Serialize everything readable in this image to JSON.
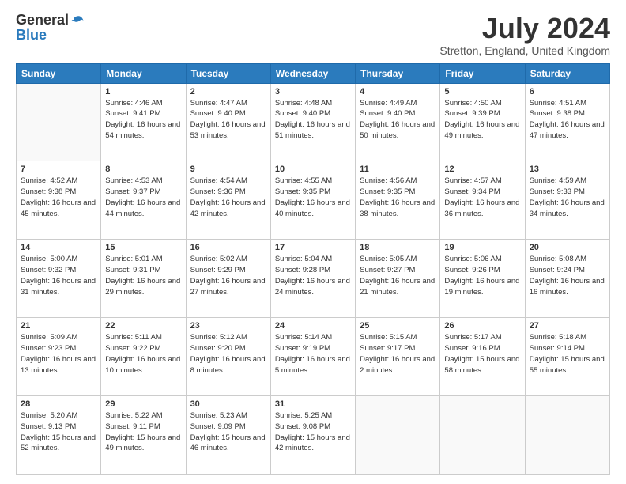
{
  "logo": {
    "general": "General",
    "blue": "Blue"
  },
  "header": {
    "month": "July 2024",
    "location": "Stretton, England, United Kingdom"
  },
  "weekdays": [
    "Sunday",
    "Monday",
    "Tuesday",
    "Wednesday",
    "Thursday",
    "Friday",
    "Saturday"
  ],
  "weeks": [
    [
      {
        "day": "",
        "sunrise": "",
        "sunset": "",
        "daylight": ""
      },
      {
        "day": "1",
        "sunrise": "Sunrise: 4:46 AM",
        "sunset": "Sunset: 9:41 PM",
        "daylight": "Daylight: 16 hours and 54 minutes."
      },
      {
        "day": "2",
        "sunrise": "Sunrise: 4:47 AM",
        "sunset": "Sunset: 9:40 PM",
        "daylight": "Daylight: 16 hours and 53 minutes."
      },
      {
        "day": "3",
        "sunrise": "Sunrise: 4:48 AM",
        "sunset": "Sunset: 9:40 PM",
        "daylight": "Daylight: 16 hours and 51 minutes."
      },
      {
        "day": "4",
        "sunrise": "Sunrise: 4:49 AM",
        "sunset": "Sunset: 9:40 PM",
        "daylight": "Daylight: 16 hours and 50 minutes."
      },
      {
        "day": "5",
        "sunrise": "Sunrise: 4:50 AM",
        "sunset": "Sunset: 9:39 PM",
        "daylight": "Daylight: 16 hours and 49 minutes."
      },
      {
        "day": "6",
        "sunrise": "Sunrise: 4:51 AM",
        "sunset": "Sunset: 9:38 PM",
        "daylight": "Daylight: 16 hours and 47 minutes."
      }
    ],
    [
      {
        "day": "7",
        "sunrise": "Sunrise: 4:52 AM",
        "sunset": "Sunset: 9:38 PM",
        "daylight": "Daylight: 16 hours and 45 minutes."
      },
      {
        "day": "8",
        "sunrise": "Sunrise: 4:53 AM",
        "sunset": "Sunset: 9:37 PM",
        "daylight": "Daylight: 16 hours and 44 minutes."
      },
      {
        "day": "9",
        "sunrise": "Sunrise: 4:54 AM",
        "sunset": "Sunset: 9:36 PM",
        "daylight": "Daylight: 16 hours and 42 minutes."
      },
      {
        "day": "10",
        "sunrise": "Sunrise: 4:55 AM",
        "sunset": "Sunset: 9:35 PM",
        "daylight": "Daylight: 16 hours and 40 minutes."
      },
      {
        "day": "11",
        "sunrise": "Sunrise: 4:56 AM",
        "sunset": "Sunset: 9:35 PM",
        "daylight": "Daylight: 16 hours and 38 minutes."
      },
      {
        "day": "12",
        "sunrise": "Sunrise: 4:57 AM",
        "sunset": "Sunset: 9:34 PM",
        "daylight": "Daylight: 16 hours and 36 minutes."
      },
      {
        "day": "13",
        "sunrise": "Sunrise: 4:59 AM",
        "sunset": "Sunset: 9:33 PM",
        "daylight": "Daylight: 16 hours and 34 minutes."
      }
    ],
    [
      {
        "day": "14",
        "sunrise": "Sunrise: 5:00 AM",
        "sunset": "Sunset: 9:32 PM",
        "daylight": "Daylight: 16 hours and 31 minutes."
      },
      {
        "day": "15",
        "sunrise": "Sunrise: 5:01 AM",
        "sunset": "Sunset: 9:31 PM",
        "daylight": "Daylight: 16 hours and 29 minutes."
      },
      {
        "day": "16",
        "sunrise": "Sunrise: 5:02 AM",
        "sunset": "Sunset: 9:29 PM",
        "daylight": "Daylight: 16 hours and 27 minutes."
      },
      {
        "day": "17",
        "sunrise": "Sunrise: 5:04 AM",
        "sunset": "Sunset: 9:28 PM",
        "daylight": "Daylight: 16 hours and 24 minutes."
      },
      {
        "day": "18",
        "sunrise": "Sunrise: 5:05 AM",
        "sunset": "Sunset: 9:27 PM",
        "daylight": "Daylight: 16 hours and 21 minutes."
      },
      {
        "day": "19",
        "sunrise": "Sunrise: 5:06 AM",
        "sunset": "Sunset: 9:26 PM",
        "daylight": "Daylight: 16 hours and 19 minutes."
      },
      {
        "day": "20",
        "sunrise": "Sunrise: 5:08 AM",
        "sunset": "Sunset: 9:24 PM",
        "daylight": "Daylight: 16 hours and 16 minutes."
      }
    ],
    [
      {
        "day": "21",
        "sunrise": "Sunrise: 5:09 AM",
        "sunset": "Sunset: 9:23 PM",
        "daylight": "Daylight: 16 hours and 13 minutes."
      },
      {
        "day": "22",
        "sunrise": "Sunrise: 5:11 AM",
        "sunset": "Sunset: 9:22 PM",
        "daylight": "Daylight: 16 hours and 10 minutes."
      },
      {
        "day": "23",
        "sunrise": "Sunrise: 5:12 AM",
        "sunset": "Sunset: 9:20 PM",
        "daylight": "Daylight: 16 hours and 8 minutes."
      },
      {
        "day": "24",
        "sunrise": "Sunrise: 5:14 AM",
        "sunset": "Sunset: 9:19 PM",
        "daylight": "Daylight: 16 hours and 5 minutes."
      },
      {
        "day": "25",
        "sunrise": "Sunrise: 5:15 AM",
        "sunset": "Sunset: 9:17 PM",
        "daylight": "Daylight: 16 hours and 2 minutes."
      },
      {
        "day": "26",
        "sunrise": "Sunrise: 5:17 AM",
        "sunset": "Sunset: 9:16 PM",
        "daylight": "Daylight: 15 hours and 58 minutes."
      },
      {
        "day": "27",
        "sunrise": "Sunrise: 5:18 AM",
        "sunset": "Sunset: 9:14 PM",
        "daylight": "Daylight: 15 hours and 55 minutes."
      }
    ],
    [
      {
        "day": "28",
        "sunrise": "Sunrise: 5:20 AM",
        "sunset": "Sunset: 9:13 PM",
        "daylight": "Daylight: 15 hours and 52 minutes."
      },
      {
        "day": "29",
        "sunrise": "Sunrise: 5:22 AM",
        "sunset": "Sunset: 9:11 PM",
        "daylight": "Daylight: 15 hours and 49 minutes."
      },
      {
        "day": "30",
        "sunrise": "Sunrise: 5:23 AM",
        "sunset": "Sunset: 9:09 PM",
        "daylight": "Daylight: 15 hours and 46 minutes."
      },
      {
        "day": "31",
        "sunrise": "Sunrise: 5:25 AM",
        "sunset": "Sunset: 9:08 PM",
        "daylight": "Daylight: 15 hours and 42 minutes."
      },
      {
        "day": "",
        "sunrise": "",
        "sunset": "",
        "daylight": ""
      },
      {
        "day": "",
        "sunrise": "",
        "sunset": "",
        "daylight": ""
      },
      {
        "day": "",
        "sunrise": "",
        "sunset": "",
        "daylight": ""
      }
    ]
  ]
}
